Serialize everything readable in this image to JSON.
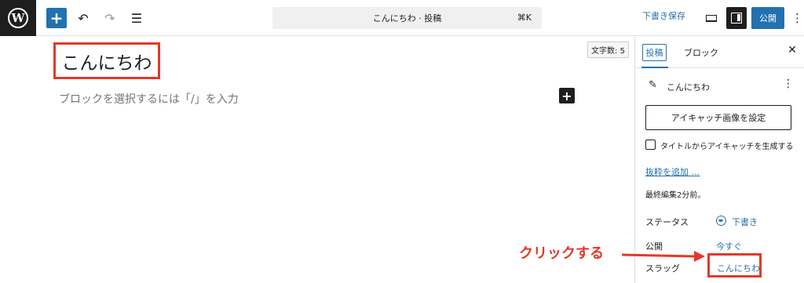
{
  "topbar": {
    "logo_letter": "W",
    "add_glyph": "+",
    "undo_glyph": "↶",
    "redo_glyph": "↷",
    "listview_glyph": "☰",
    "command": "こんにちわ · 投稿",
    "command_shortcut": "⌘K",
    "save_draft": "下書き保存",
    "publish": "公開",
    "more_glyph": "⋮"
  },
  "editor": {
    "title": "こんにちわ",
    "word_count": "文字数: 5",
    "placeholder": "ブロックを選択するには「/」を入力",
    "inline_add_glyph": "+"
  },
  "sidebar": {
    "tabs": {
      "post": "投稿",
      "block": "ブロック"
    },
    "close_glyph": "✕",
    "post_card": {
      "icon_glyph": "✎",
      "title": "こんにちわ",
      "more_glyph": "⋮"
    },
    "featured_image_button": "アイキャッチ画像を設定",
    "generate_from_title": "タイトルからアイキャッチを生成する",
    "add_excerpt": "抜粋を追加 …",
    "last_edited": "最終編集2分前。",
    "rows": {
      "status": {
        "label": "ステータス",
        "value": "下書き"
      },
      "publish": {
        "label": "公開",
        "value": "今すぐ"
      },
      "slug": {
        "label": "スラッグ",
        "value": "こんにちわ"
      }
    }
  },
  "annotation": {
    "text": "クリックする",
    "color": "#e2392a"
  },
  "colors": {
    "accent": "#2271b1",
    "dark": "#1e1e1e",
    "highlight": "#e2392a"
  }
}
